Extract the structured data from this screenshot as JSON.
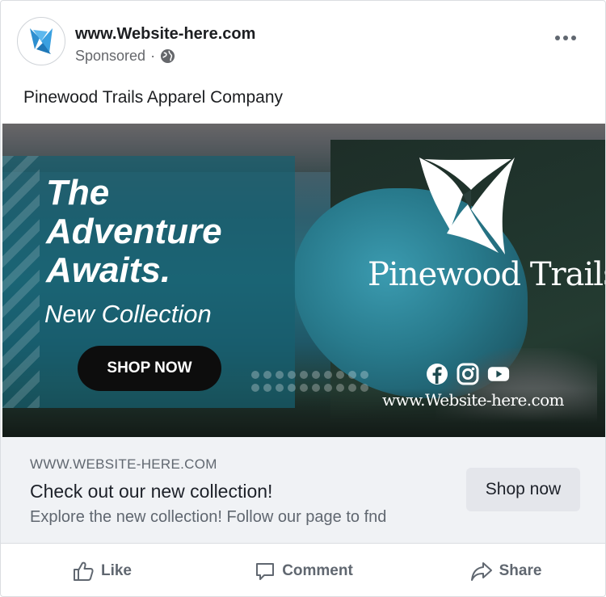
{
  "header": {
    "page_name": "www.Website-here.com",
    "sponsored": "Sponsored",
    "separator": "·",
    "avatar_icon": "pinewood-logo-icon",
    "privacy_icon": "globe-icon",
    "more_icon": "more-options-icon"
  },
  "post": {
    "caption": "Pinewood Trails Apparel Company"
  },
  "ad": {
    "headline_line1": "The",
    "headline_line2": "Adventure",
    "headline_line3": "Awaits.",
    "subheadline": "New Collection",
    "cta": "SHOP NOW",
    "brand": "Pinewood Trails",
    "url": "www.Website-here.com",
    "social_icons": [
      "facebook-icon",
      "instagram-icon",
      "youtube-icon"
    ],
    "panel_color": "#166070"
  },
  "link": {
    "domain": "WWW.WEBSITE-HERE.COM",
    "title": "Check out our new collection!",
    "description": "Explore the new collection! Follow our page to fnd",
    "button": "Shop now"
  },
  "actions": [
    {
      "label": "Like",
      "icon": "thumbs-up-icon"
    },
    {
      "label": "Comment",
      "icon": "comment-icon"
    },
    {
      "label": "Share",
      "icon": "share-icon"
    }
  ],
  "colors": {
    "secondary_text": "#65676b",
    "strip_bg": "#f0f2f5",
    "button_bg": "#e4e6eb"
  }
}
